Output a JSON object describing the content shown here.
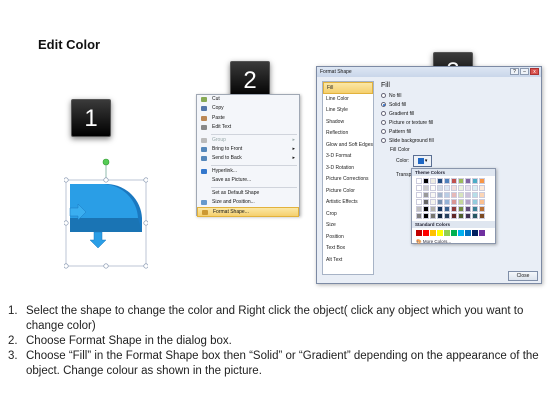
{
  "title": "Edit Color",
  "badges": [
    "1",
    "2",
    "3"
  ],
  "context_menu": {
    "items": [
      {
        "label": "Cut",
        "disabled": false,
        "icon": "scissors-icon",
        "color": "#8a5"
      },
      {
        "label": "Copy",
        "disabled": false,
        "icon": "copy-icon",
        "color": "#57a"
      },
      {
        "label": "Paste",
        "disabled": false,
        "icon": "paste-icon",
        "color": "#b85"
      },
      {
        "label": "Edit Text",
        "disabled": false,
        "icon": "edit-text-icon",
        "color": "#888"
      },
      {
        "label": "Group",
        "disabled": true,
        "icon": "group-icon",
        "color": "#bbb",
        "submenu": true
      },
      {
        "label": "Bring to Front",
        "disabled": false,
        "icon": "bring-front-icon",
        "color": "#58b",
        "submenu": true
      },
      {
        "label": "Send to Back",
        "disabled": false,
        "icon": "send-back-icon",
        "color": "#58b",
        "submenu": true
      },
      {
        "label": "Hyperlink...",
        "disabled": false,
        "icon": "hyperlink-icon",
        "color": "#37c"
      },
      {
        "label": "Save as Picture...",
        "disabled": false,
        "icon": "",
        "color": ""
      },
      {
        "label": "Set as Default Shape",
        "disabled": false,
        "icon": "",
        "color": ""
      },
      {
        "label": "Size and Position...",
        "disabled": false,
        "icon": "size-icon",
        "color": "#69c"
      },
      {
        "label": "Format Shape...",
        "disabled": false,
        "icon": "format-shape-icon",
        "color": "#c93",
        "selected": true
      }
    ]
  },
  "format_dialog": {
    "title": "Format Shape",
    "controls": [
      "?",
      "–",
      "x"
    ],
    "categories": [
      "Fill",
      "Line Color",
      "Line Style",
      "Shadow",
      "Reflection",
      "Glow and Soft Edges",
      "3-D Format",
      "3-D Rotation",
      "Picture Corrections",
      "Picture Color",
      "Artistic Effects",
      "Crop",
      "Size",
      "Position",
      "Text Box",
      "Alt Text"
    ],
    "selected_category": "Fill",
    "fill_heading": "Fill",
    "options": [
      {
        "label": "No fill",
        "on": false
      },
      {
        "label": "Solid fill",
        "on": true
      },
      {
        "label": "Gradient fill",
        "on": false
      },
      {
        "label": "Picture or texture fill",
        "on": false
      },
      {
        "label": "Pattern fill",
        "on": false
      },
      {
        "label": "Slide background fill",
        "on": false
      }
    ],
    "fill_color_label": "Fill Color",
    "color_label": "Color:",
    "transparency_label": "Transpa",
    "theme_colors_label": "Theme Colors",
    "standard_colors_label": "Standard Colors",
    "more_colors_label": "More Colors...",
    "close_label": "Close"
  },
  "theme_top": [
    "#ffffff",
    "#000000",
    "#eeece1",
    "#1f497d",
    "#4f81bd",
    "#c0504d",
    "#9bbb59",
    "#8064a2",
    "#4bacc6",
    "#f79646"
  ],
  "standard_colors": [
    "#c00000",
    "#ff0000",
    "#ffc000",
    "#ffff00",
    "#92d050",
    "#00b050",
    "#00b0f0",
    "#0070c0",
    "#002060",
    "#7030a0"
  ],
  "instructions": [
    {
      "num": "1.",
      "text": "Select the shape to change the color and Right click the object( click any object which you want to change color)"
    },
    {
      "num": "2.",
      "text": "Choose Format Shape in the dialog box."
    },
    {
      "num": "3.",
      "text": "Choose “Fill” in the Format Shape box then “Solid” or “Gradient” depending on the appearance of the object. Change colour as shown in the picture."
    }
  ],
  "colors": {
    "shape_blue": "#2a9ee6",
    "shape_dark": "#1a78c0",
    "accent": "#f5cf6d"
  }
}
